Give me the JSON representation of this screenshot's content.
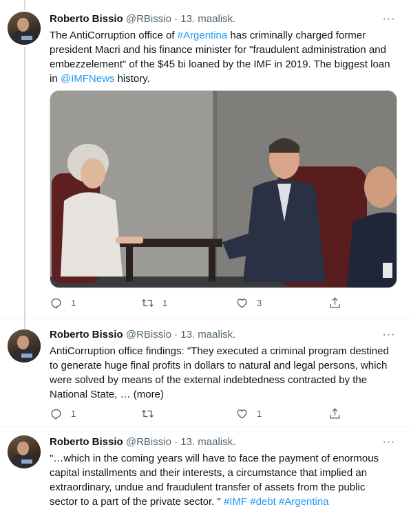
{
  "tweets": [
    {
      "author_name": "Roberto Bissio",
      "handle": "@RBissio",
      "separator": "·",
      "date": "13. maalisk.",
      "text_parts": [
        {
          "t": "The AntiCorruption office of ",
          "link": false
        },
        {
          "t": "#Argentina",
          "link": true
        },
        {
          "t": " has criminally charged former president Macri and his finance minister for \"fraudulent administration and embezzelement\" of the $45 bi loaned by the IMF in 2019. The biggest loan in ",
          "link": false
        },
        {
          "t": "@IMFNews",
          "link": true
        },
        {
          "t": " history.",
          "link": false
        }
      ],
      "has_media": true,
      "counts": {
        "replies": "1",
        "retweets": "1",
        "likes": "3"
      }
    },
    {
      "author_name": "Roberto Bissio",
      "handle": "@RBissio",
      "separator": "·",
      "date": "13. maalisk.",
      "text_parts": [
        {
          "t": "AntiCorruption office findings: \"They executed a criminal program destined to generate huge final profits in dollars to natural and legal persons, which were solved by means of the external indebtedness contracted by the National State,  … ",
          "link": false
        },
        {
          "t": "(more)",
          "link": false
        }
      ],
      "has_media": false,
      "counts": {
        "replies": "1",
        "retweets": "",
        "likes": "1"
      }
    },
    {
      "author_name": "Roberto Bissio",
      "handle": "@RBissio",
      "separator": "·",
      "date": "13. maalisk.",
      "text_parts": [
        {
          "t": "\"…which in the coming years will have to face the payment of enormous capital installments and their interests, a circumstance that implied an extraordinary, undue and fraudulent transfer of assets from the public sector to a part of the private sector. \" ",
          "link": false
        },
        {
          "t": "#IMF",
          "link": true
        },
        {
          "t": " ",
          "link": false
        },
        {
          "t": "#debt",
          "link": true
        },
        {
          "t": " ",
          "link": false
        },
        {
          "t": "#Argentina",
          "link": true
        }
      ],
      "has_media": false,
      "counts": {
        "replies": "",
        "retweets": "",
        "likes": ""
      }
    }
  ],
  "icons": {
    "more": "more-horizontal-icon",
    "reply": "reply-icon",
    "retweet": "retweet-icon",
    "like": "like-icon",
    "share": "share-icon"
  },
  "colors": {
    "link": "#1d9bf0",
    "muted": "#536471",
    "text": "#0f1419"
  }
}
